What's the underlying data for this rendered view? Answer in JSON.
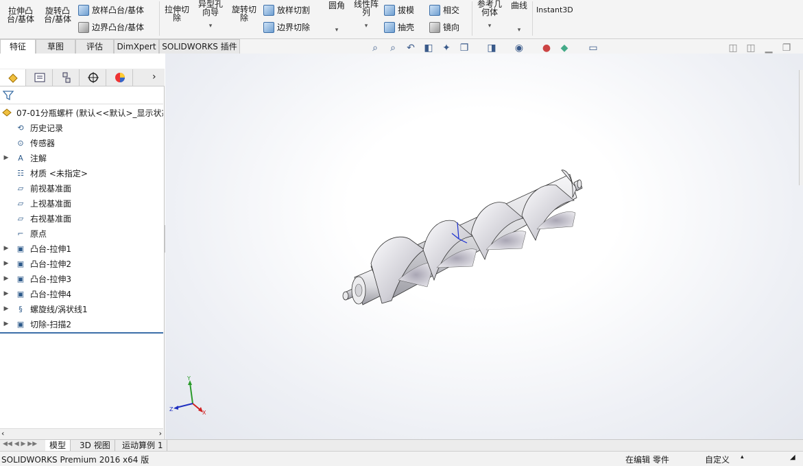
{
  "ribbon": {
    "extrude_boss": "拉伸凸\n台/基体",
    "revolve_boss": "旋转凸\n台/基体",
    "loft_boss": "放样凸台/基体",
    "boundary_boss": "边界凸台/基体",
    "extrude_cut": "拉伸切\n除",
    "hole_wizard": "异型孔\n向导",
    "revolve_cut": "旋转切\n除",
    "loft_cut": "放样切割",
    "boundary_cut": "边界切除",
    "fillet": "圆角",
    "linear_pattern": "线性阵\n列",
    "draft": "拔模",
    "shell": "抽壳",
    "intersect": "相交",
    "mirror": "镜向",
    "ref_geometry": "参考几\n何体",
    "curves": "曲线",
    "instant3d": "Instant3D"
  },
  "tabs": [
    "特征",
    "草图",
    "评估",
    "DimXpert",
    "SOLIDWORKS 插件"
  ],
  "tree": {
    "root": "07-01分瓶螺杆 (默认<<默认>_显示状态",
    "items": [
      {
        "label": "历史记录",
        "expandable": false
      },
      {
        "label": "传感器",
        "expandable": false
      },
      {
        "label": "注解",
        "expandable": true
      },
      {
        "label": "材质 <未指定>",
        "expandable": false
      },
      {
        "label": "前视基准面",
        "expandable": false
      },
      {
        "label": "上视基准面",
        "expandable": false
      },
      {
        "label": "右视基准面",
        "expandable": false
      },
      {
        "label": "原点",
        "expandable": false
      },
      {
        "label": "凸台-拉伸1",
        "expandable": true
      },
      {
        "label": "凸台-拉伸2",
        "expandable": true
      },
      {
        "label": "凸台-拉伸3",
        "expandable": true
      },
      {
        "label": "凸台-拉伸4",
        "expandable": true
      },
      {
        "label": "螺旋线/涡状线1",
        "expandable": true
      },
      {
        "label": "切除-扫描2",
        "expandable": true
      }
    ]
  },
  "triad": {
    "x": "X",
    "y": "Y",
    "z": "Z"
  },
  "bottom_tabs": [
    "模型",
    "3D 视图",
    "运动算例 1"
  ],
  "status": {
    "app": "SOLIDWORKS Premium 2016 x64 版",
    "editing": "在编辑 零件",
    "units": "自定义"
  },
  "colors": {
    "accent": "#3b6ea8",
    "ribbon_bg": "#f4f4f4"
  }
}
